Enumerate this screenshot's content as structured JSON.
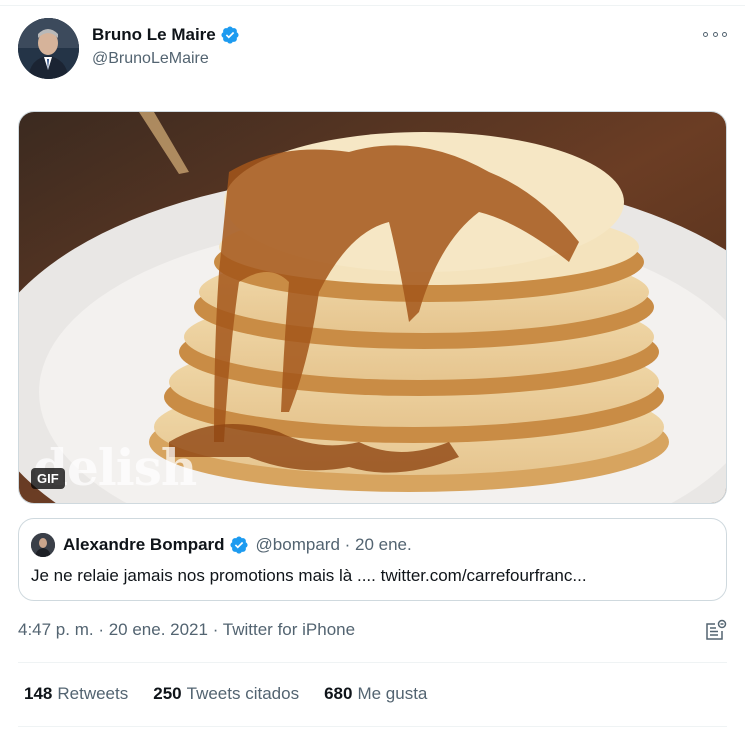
{
  "tweet": {
    "author_name": "Bruno Le Maire",
    "author_handle": "@BrunoLeMaire",
    "media_badge": "GIF",
    "media_watermark": "delish",
    "timestamp": "4:47 p. m. · 20 ene. 2021",
    "separator": " · ",
    "source": "Twitter for iPhone"
  },
  "quoted_tweet": {
    "author_name": "Alexandre Bompard",
    "author_handle": "@bompard · 20 ene.",
    "text": "Je ne relaie jamais nos promotions mais là .... twitter.com/carrefourfranc..."
  },
  "stats": [
    {
      "value": "148",
      "label": "Retweets"
    },
    {
      "value": "250",
      "label": "Tweets citados"
    },
    {
      "value": "680",
      "label": "Me gusta"
    }
  ],
  "colors": {
    "verified": "#1d9bf0",
    "secondary_text": "#536471",
    "border": "#cfd9de"
  },
  "icons": {
    "more": "more-icon",
    "verified": "verified-badge-icon",
    "analytics": "analytics-icon"
  }
}
